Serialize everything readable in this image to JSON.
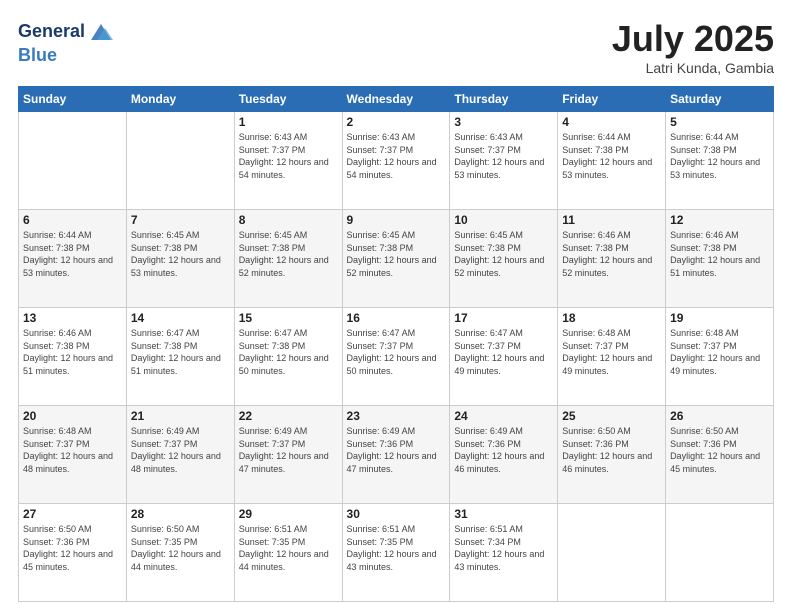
{
  "header": {
    "logo_line1": "General",
    "logo_line2": "Blue",
    "month_year": "July 2025",
    "location": "Latri Kunda, Gambia"
  },
  "days_of_week": [
    "Sunday",
    "Monday",
    "Tuesday",
    "Wednesday",
    "Thursday",
    "Friday",
    "Saturday"
  ],
  "weeks": [
    [
      {
        "day": "",
        "sunrise": "",
        "sunset": "",
        "daylight": ""
      },
      {
        "day": "",
        "sunrise": "",
        "sunset": "",
        "daylight": ""
      },
      {
        "day": "1",
        "sunrise": "Sunrise: 6:43 AM",
        "sunset": "Sunset: 7:37 PM",
        "daylight": "Daylight: 12 hours and 54 minutes."
      },
      {
        "day": "2",
        "sunrise": "Sunrise: 6:43 AM",
        "sunset": "Sunset: 7:37 PM",
        "daylight": "Daylight: 12 hours and 54 minutes."
      },
      {
        "day": "3",
        "sunrise": "Sunrise: 6:43 AM",
        "sunset": "Sunset: 7:37 PM",
        "daylight": "Daylight: 12 hours and 53 minutes."
      },
      {
        "day": "4",
        "sunrise": "Sunrise: 6:44 AM",
        "sunset": "Sunset: 7:38 PM",
        "daylight": "Daylight: 12 hours and 53 minutes."
      },
      {
        "day": "5",
        "sunrise": "Sunrise: 6:44 AM",
        "sunset": "Sunset: 7:38 PM",
        "daylight": "Daylight: 12 hours and 53 minutes."
      }
    ],
    [
      {
        "day": "6",
        "sunrise": "Sunrise: 6:44 AM",
        "sunset": "Sunset: 7:38 PM",
        "daylight": "Daylight: 12 hours and 53 minutes."
      },
      {
        "day": "7",
        "sunrise": "Sunrise: 6:45 AM",
        "sunset": "Sunset: 7:38 PM",
        "daylight": "Daylight: 12 hours and 53 minutes."
      },
      {
        "day": "8",
        "sunrise": "Sunrise: 6:45 AM",
        "sunset": "Sunset: 7:38 PM",
        "daylight": "Daylight: 12 hours and 52 minutes."
      },
      {
        "day": "9",
        "sunrise": "Sunrise: 6:45 AM",
        "sunset": "Sunset: 7:38 PM",
        "daylight": "Daylight: 12 hours and 52 minutes."
      },
      {
        "day": "10",
        "sunrise": "Sunrise: 6:45 AM",
        "sunset": "Sunset: 7:38 PM",
        "daylight": "Daylight: 12 hours and 52 minutes."
      },
      {
        "day": "11",
        "sunrise": "Sunrise: 6:46 AM",
        "sunset": "Sunset: 7:38 PM",
        "daylight": "Daylight: 12 hours and 52 minutes."
      },
      {
        "day": "12",
        "sunrise": "Sunrise: 6:46 AM",
        "sunset": "Sunset: 7:38 PM",
        "daylight": "Daylight: 12 hours and 51 minutes."
      }
    ],
    [
      {
        "day": "13",
        "sunrise": "Sunrise: 6:46 AM",
        "sunset": "Sunset: 7:38 PM",
        "daylight": "Daylight: 12 hours and 51 minutes."
      },
      {
        "day": "14",
        "sunrise": "Sunrise: 6:47 AM",
        "sunset": "Sunset: 7:38 PM",
        "daylight": "Daylight: 12 hours and 51 minutes."
      },
      {
        "day": "15",
        "sunrise": "Sunrise: 6:47 AM",
        "sunset": "Sunset: 7:38 PM",
        "daylight": "Daylight: 12 hours and 50 minutes."
      },
      {
        "day": "16",
        "sunrise": "Sunrise: 6:47 AM",
        "sunset": "Sunset: 7:37 PM",
        "daylight": "Daylight: 12 hours and 50 minutes."
      },
      {
        "day": "17",
        "sunrise": "Sunrise: 6:47 AM",
        "sunset": "Sunset: 7:37 PM",
        "daylight": "Daylight: 12 hours and 49 minutes."
      },
      {
        "day": "18",
        "sunrise": "Sunrise: 6:48 AM",
        "sunset": "Sunset: 7:37 PM",
        "daylight": "Daylight: 12 hours and 49 minutes."
      },
      {
        "day": "19",
        "sunrise": "Sunrise: 6:48 AM",
        "sunset": "Sunset: 7:37 PM",
        "daylight": "Daylight: 12 hours and 49 minutes."
      }
    ],
    [
      {
        "day": "20",
        "sunrise": "Sunrise: 6:48 AM",
        "sunset": "Sunset: 7:37 PM",
        "daylight": "Daylight: 12 hours and 48 minutes."
      },
      {
        "day": "21",
        "sunrise": "Sunrise: 6:49 AM",
        "sunset": "Sunset: 7:37 PM",
        "daylight": "Daylight: 12 hours and 48 minutes."
      },
      {
        "day": "22",
        "sunrise": "Sunrise: 6:49 AM",
        "sunset": "Sunset: 7:37 PM",
        "daylight": "Daylight: 12 hours and 47 minutes."
      },
      {
        "day": "23",
        "sunrise": "Sunrise: 6:49 AM",
        "sunset": "Sunset: 7:36 PM",
        "daylight": "Daylight: 12 hours and 47 minutes."
      },
      {
        "day": "24",
        "sunrise": "Sunrise: 6:49 AM",
        "sunset": "Sunset: 7:36 PM",
        "daylight": "Daylight: 12 hours and 46 minutes."
      },
      {
        "day": "25",
        "sunrise": "Sunrise: 6:50 AM",
        "sunset": "Sunset: 7:36 PM",
        "daylight": "Daylight: 12 hours and 46 minutes."
      },
      {
        "day": "26",
        "sunrise": "Sunrise: 6:50 AM",
        "sunset": "Sunset: 7:36 PM",
        "daylight": "Daylight: 12 hours and 45 minutes."
      }
    ],
    [
      {
        "day": "27",
        "sunrise": "Sunrise: 6:50 AM",
        "sunset": "Sunset: 7:36 PM",
        "daylight": "Daylight: 12 hours and 45 minutes."
      },
      {
        "day": "28",
        "sunrise": "Sunrise: 6:50 AM",
        "sunset": "Sunset: 7:35 PM",
        "daylight": "Daylight: 12 hours and 44 minutes."
      },
      {
        "day": "29",
        "sunrise": "Sunrise: 6:51 AM",
        "sunset": "Sunset: 7:35 PM",
        "daylight": "Daylight: 12 hours and 44 minutes."
      },
      {
        "day": "30",
        "sunrise": "Sunrise: 6:51 AM",
        "sunset": "Sunset: 7:35 PM",
        "daylight": "Daylight: 12 hours and 43 minutes."
      },
      {
        "day": "31",
        "sunrise": "Sunrise: 6:51 AM",
        "sunset": "Sunset: 7:34 PM",
        "daylight": "Daylight: 12 hours and 43 minutes."
      },
      {
        "day": "",
        "sunrise": "",
        "sunset": "",
        "daylight": ""
      },
      {
        "day": "",
        "sunrise": "",
        "sunset": "",
        "daylight": ""
      }
    ]
  ]
}
